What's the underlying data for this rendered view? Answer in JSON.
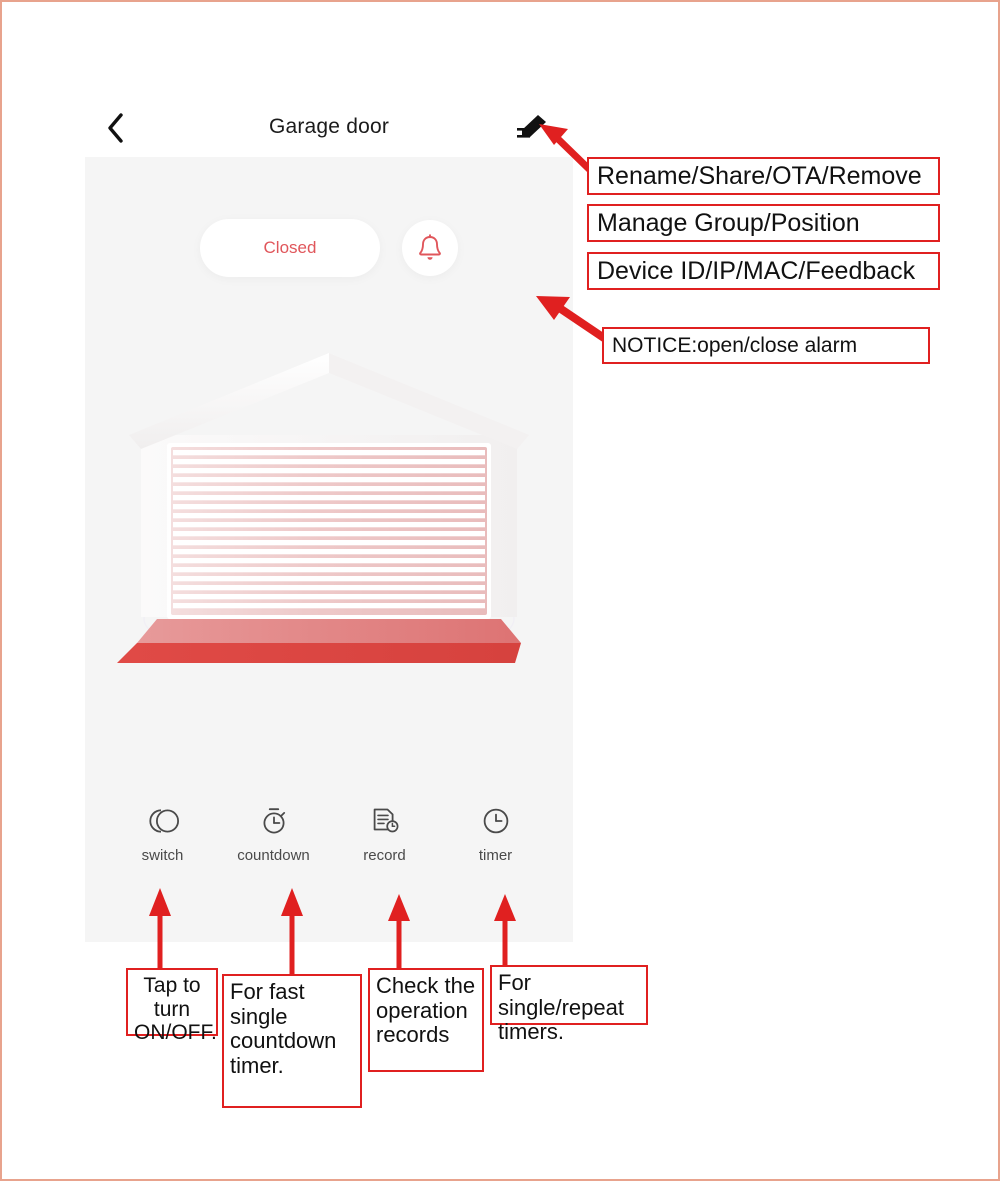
{
  "app": {
    "title": "Garage door",
    "back_icon": "chevron-left-icon",
    "edit_icon": "pencil-edit-icon",
    "status_label": "Closed",
    "alarm_icon": "bell-icon",
    "illustration": "garage-door-closed-illustration",
    "toolbar": [
      {
        "label": "switch",
        "icon": "toggle-switch-icon"
      },
      {
        "label": "countdown",
        "icon": "stopwatch-icon"
      },
      {
        "label": "record",
        "icon": "document-clock-icon"
      },
      {
        "label": "timer",
        "icon": "clock-icon"
      }
    ]
  },
  "annotations": {
    "rename": "Rename/Share/OTA/Remove",
    "group": "Manage Group/Position",
    "device": "Device ID/IP/MAC/Feedback",
    "notice": "NOTICE:open/close alarm",
    "switch": "Tap to turn ON/OFF.",
    "countdown": "For fast single countdown timer.",
    "record": "Check the operation records",
    "timer": "For single/repeat timers."
  },
  "colors": {
    "annotation_border": "#e02020",
    "arrow": "#e02020",
    "status_text": "#e0565b",
    "screen_bg": "#f5f5f5",
    "page_border": "#e8a38d",
    "door_accent": "#e0565b"
  }
}
